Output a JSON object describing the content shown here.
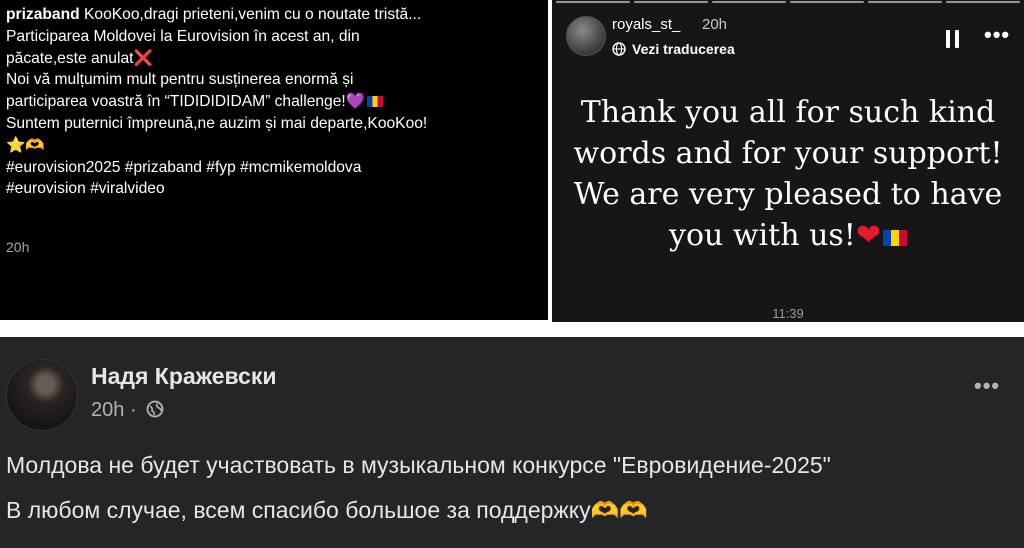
{
  "tiktok": {
    "username": "prizaband",
    "line1": "KooKoo,dragi prieteni,venim cu o noutate tristă...",
    "line2": "Participarea Moldovei la Eurovision în acest an, din",
    "line3": "păcate,este anulat",
    "line4": "Noi vă mulțumim mult pentru susținerea enormă și",
    "line5": "participarea voastră în “TIDIDIDIDAM” challenge!",
    "line6": "Suntem puternici împreună,ne auzim și mai departe,KooKoo!",
    "line8": "#eurovision2025 #prizaband #fyp #mcmikemoldova",
    "line9": "#eurovision #viralvideo",
    "time": "20h"
  },
  "instagram": {
    "username": "royals_st_",
    "time": "20h",
    "translate_label": "Vezi traducerea",
    "message": "Thank you all for such kind words and for your support! We are very pleased to have you with us!",
    "clock": "11:39",
    "progress_segments": 6
  },
  "facebook": {
    "name": "Надя Кражевски",
    "time": "20h",
    "separator": "·",
    "line1": "Молдова не будет участвовать в музыкальном конкурсе \"Евровидение-2025\"",
    "line2": "В любом случае, всем спасибо большое за поддержку"
  },
  "icons": {
    "cross_mark": "❌",
    "purple_heart": "💜",
    "moldova_flag": "🇲🇩",
    "star": "⭐",
    "heart_hands": "🫶",
    "red_heart": "❤",
    "globe": "globe-icon",
    "pause": "pause-icon",
    "more": "more-options-icon"
  },
  "colors": {
    "tiktok_bg": "#000000",
    "instagram_bg": "#161616",
    "facebook_bg": "#242526",
    "facebook_text": "#e4e6eb",
    "facebook_secondary": "#b0b3b8"
  }
}
